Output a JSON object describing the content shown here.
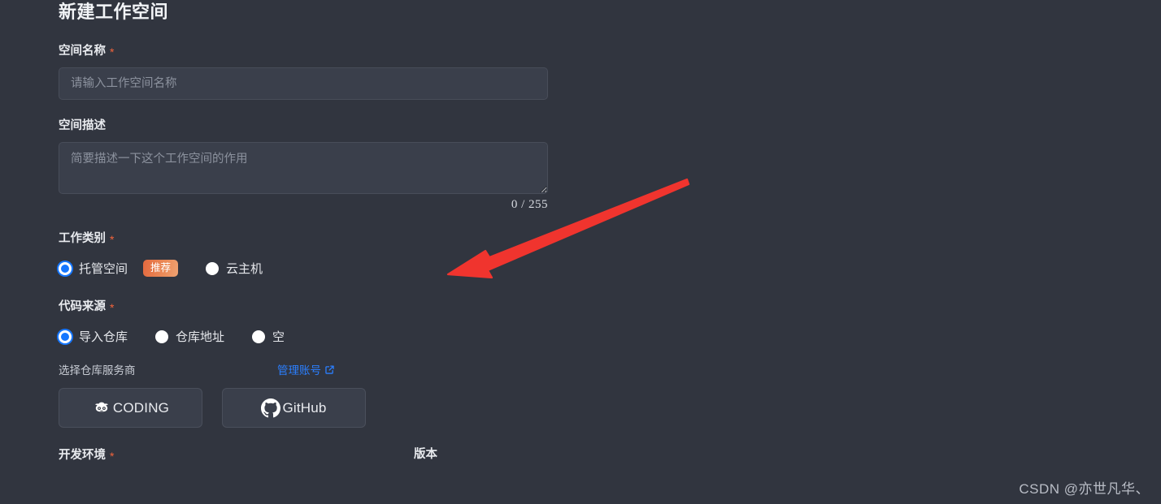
{
  "page": {
    "title": "新建工作空间",
    "background_color": "#31353F"
  },
  "fields": {
    "name": {
      "label": "空间名称",
      "required_mark": "*",
      "value": "",
      "placeholder": "请输入工作空间名称"
    },
    "description": {
      "label": "空间描述",
      "value": "",
      "placeholder": "简要描述一下这个工作空间的作用",
      "counter": "0 / 255"
    },
    "work_type": {
      "label": "工作类别",
      "required_mark": "*",
      "options": [
        {
          "label": "托管空间",
          "selected": true,
          "badge": "推荐"
        },
        {
          "label": "云主机",
          "selected": false,
          "badge": ""
        }
      ]
    },
    "code_source": {
      "label": "代码来源",
      "required_mark": "*",
      "options": [
        {
          "label": "导入仓库",
          "selected": true
        },
        {
          "label": "仓库地址",
          "selected": false
        },
        {
          "label": "空",
          "selected": false
        }
      ]
    },
    "repo_provider": {
      "sub_label": "选择仓库服务商",
      "manage_link": "管理账号",
      "manage_link_icon": "external-link-icon",
      "manage_link_color": "#2B7FFF",
      "providers": [
        {
          "name": "CODING",
          "icon": "coding-logo-icon"
        },
        {
          "name": "GitHub",
          "icon": "github-logo-icon"
        }
      ]
    },
    "dev_env": {
      "label": "开发环境",
      "required_mark": "*"
    },
    "version": {
      "label": "版本"
    }
  },
  "annotation": {
    "arrow_color": "#F0342E",
    "arrow_from": "845,222",
    "arrow_to": "552,338"
  },
  "watermark": {
    "text": "CSDN @亦世凡华、"
  }
}
